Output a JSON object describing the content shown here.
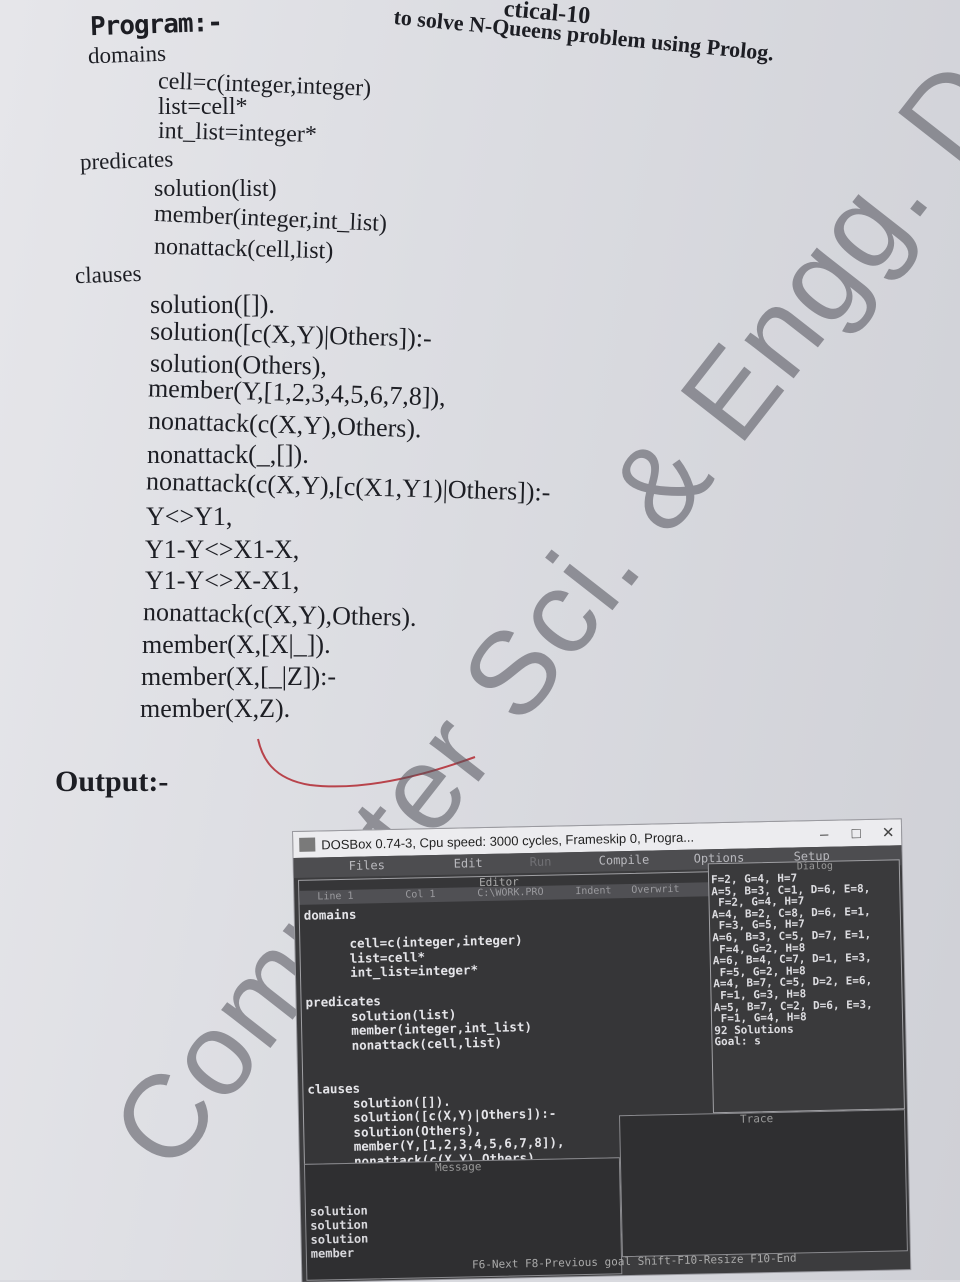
{
  "heading": {
    "title_fragment": "ctical-10",
    "line": "to solve N-Queens problem using Prolog."
  },
  "program_label": "Program:-",
  "domains": {
    "label": "domains",
    "lines": [
      "cell=c(integer,integer)",
      "list=cell*",
      "int_list=integer*"
    ]
  },
  "predicates": {
    "label": "predicates",
    "lines": [
      "solution(list)",
      "member(integer,int_list)",
      "nonattack(cell,list)"
    ]
  },
  "clauses": {
    "label": "clauses",
    "lines": [
      "solution([]).",
      "solution([c(X,Y)|Others]):-",
      "solution(Others),",
      "member(Y,[1,2,3,4,5,6,7,8]),",
      "nonattack(c(X,Y),Others).",
      "nonattack(_,[]).",
      "nonattack(c(X,Y),[c(X1,Y1)|Others]):-",
      "Y<>Y1,",
      "Y1-Y<>X1-X,",
      "Y1-Y<>X-X1,",
      "nonattack(c(X,Y),Others).",
      "member(X,[X|_]).",
      "member(X,[_|Z]):-",
      "member(X,Z)."
    ]
  },
  "output_label": "Output:-",
  "watermark": "Computer Sci. & Engg. Dept",
  "dosbox": {
    "title": "DOSBox 0.74-3, Cpu speed:   3000 cycles, Frameskip  0, Progra...",
    "menu": [
      "Files",
      "Edit",
      "Run",
      "Compile",
      "Options",
      "Setup"
    ],
    "editor": {
      "title": "Editor",
      "line": "Line 1",
      "col": "Col 1",
      "file": "C:\\WORK.PRO",
      "indent": "Indent",
      "overwrite": "Overwrit",
      "code": "domains\n\n      cell=c(integer,integer)\n      list=cell*\n      int_list=integer*\n\npredicates\n      solution(list)\n      member(integer,int_list)\n      nonattack(cell,list)\n\n\nclauses\n      solution([]).\n      solution([c(X,Y)|Others]):-\n      solution(Others),\n      member(Y,[1,2,3,4,5,6,7,8]),\n      nonattack(c(X,Y),Others)."
    },
    "dialog": {
      "title": "Dialog",
      "lines": "F=2, G=4, H=7\nA=5, B=3, C=1, D=6, E=8,\n F=2, G=4, H=7\nA=4, B=2, C=8, D=6, E=1,\n F=3, G=5, H=7\nA=6, B=3, C=5, D=7, E=1,\n F=4, G=2, H=8\nA=6, B=4, C=7, D=1, E=3,\n F=5, G=2, H=8\nA=4, B=7, C=5, D=2, E=6,\n F=1, G=3, H=8\nA=5, B=7, C=2, D=6, E=3,\n F=1, G=4, H=8\n92 Solutions\nGoal: s"
    },
    "message": {
      "title": "Message",
      "lines": "solution\nsolution\nsolution\nmember"
    },
    "trace": {
      "title": "Trace"
    },
    "status": "F6-Next  F8-Previous goal  Shift-F10-Resize  F10-End"
  },
  "colors": {
    "paper": "#e2e3e8",
    "dos_background": "#3c3c3e",
    "dos_text": "#e4e4e8",
    "annotation_red": "#b8434b"
  }
}
